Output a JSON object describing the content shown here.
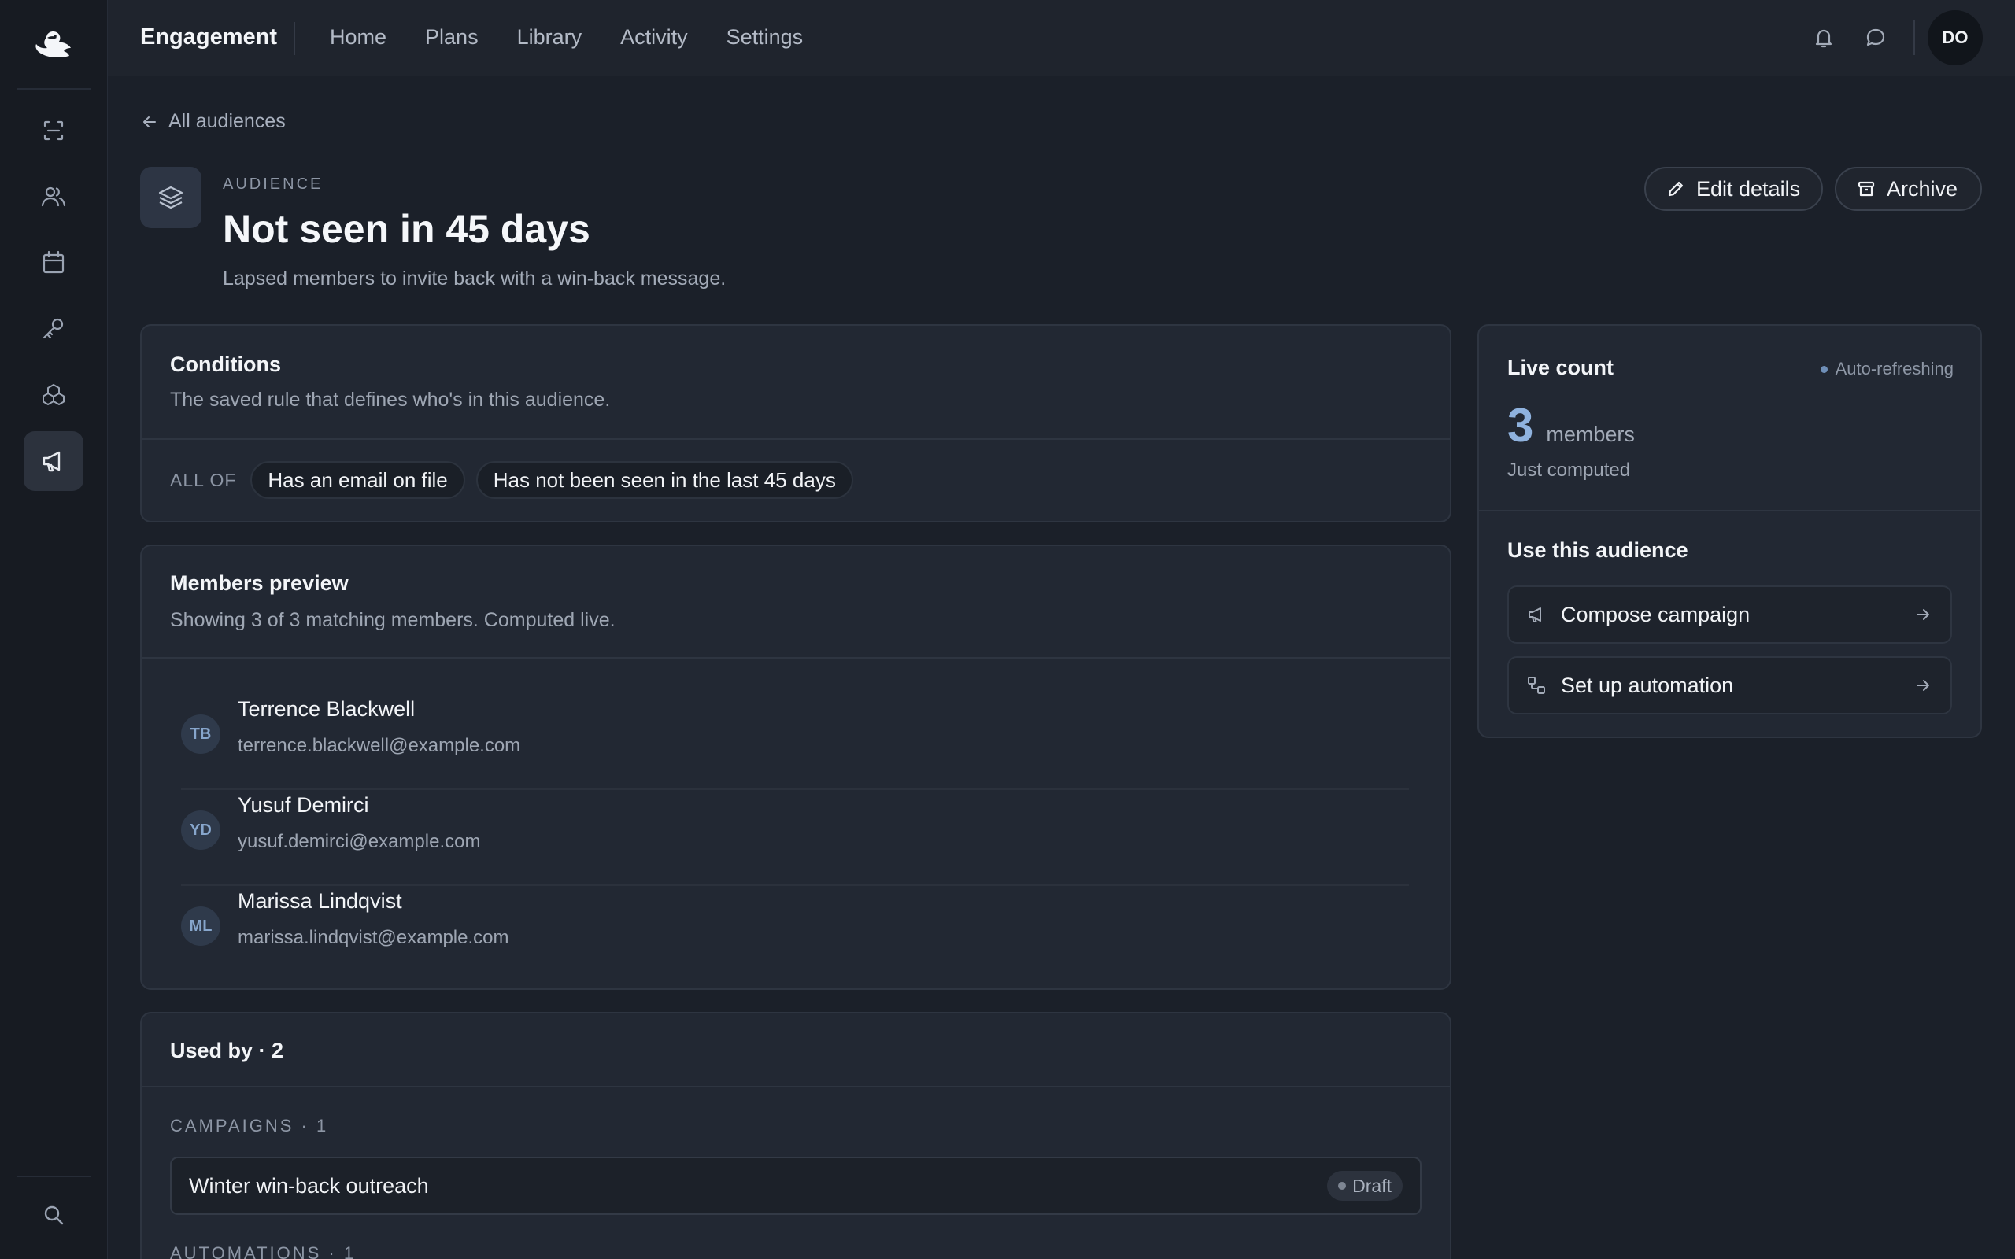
{
  "app": {
    "brand": "Engagement",
    "nav": [
      "Home",
      "Plans",
      "Library",
      "Activity",
      "Settings"
    ],
    "user_initials": "DO"
  },
  "sidebar": {
    "items": [
      "scan-icon",
      "users-icon",
      "calendar-icon",
      "key-icon",
      "boxes-icon",
      "megaphone-icon"
    ],
    "active": "megaphone-icon",
    "bottom": "search-icon"
  },
  "header": {
    "back_label": "All audiences",
    "eyebrow": "AUDIENCE",
    "title": "Not seen in 45 days",
    "description": "Lapsed members to invite back with a win-back message.",
    "edit_label": "Edit details",
    "archive_label": "Archive"
  },
  "conditions": {
    "title": "Conditions",
    "subtitle": "The saved rule that defines who's in this audience.",
    "operator": "ALL OF",
    "rules": [
      "Has an email on file",
      "Has not been seen in the last 45 days"
    ]
  },
  "members": {
    "title": "Members preview",
    "subtitle": "Showing 3 of 3 matching members. Computed live.",
    "list": [
      {
        "initials": "TB",
        "name": "Terrence Blackwell",
        "email": "terrence.blackwell@example.com"
      },
      {
        "initials": "YD",
        "name": "Yusuf Demirci",
        "email": "yusuf.demirci@example.com"
      },
      {
        "initials": "ML",
        "name": "Marissa Lindqvist",
        "email": "marissa.lindqvist@example.com"
      }
    ]
  },
  "usage": {
    "title": "Used by · 2",
    "campaigns_label": "CAMPAIGNS · 1",
    "campaign_name": "Winter win-back outreach",
    "campaign_status": "Draft",
    "automations_label": "AUTOMATIONS · 1"
  },
  "live_count": {
    "title": "Live count",
    "status": "Auto-refreshing",
    "count": "3",
    "unit": "members",
    "computed": "Just computed"
  },
  "use_audience": {
    "title": "Use this audience",
    "actions": [
      "Compose campaign",
      "Set up automation"
    ]
  },
  "colors": {
    "background": "#1b2029",
    "card": "#222833",
    "accent": "#8fb2de"
  }
}
